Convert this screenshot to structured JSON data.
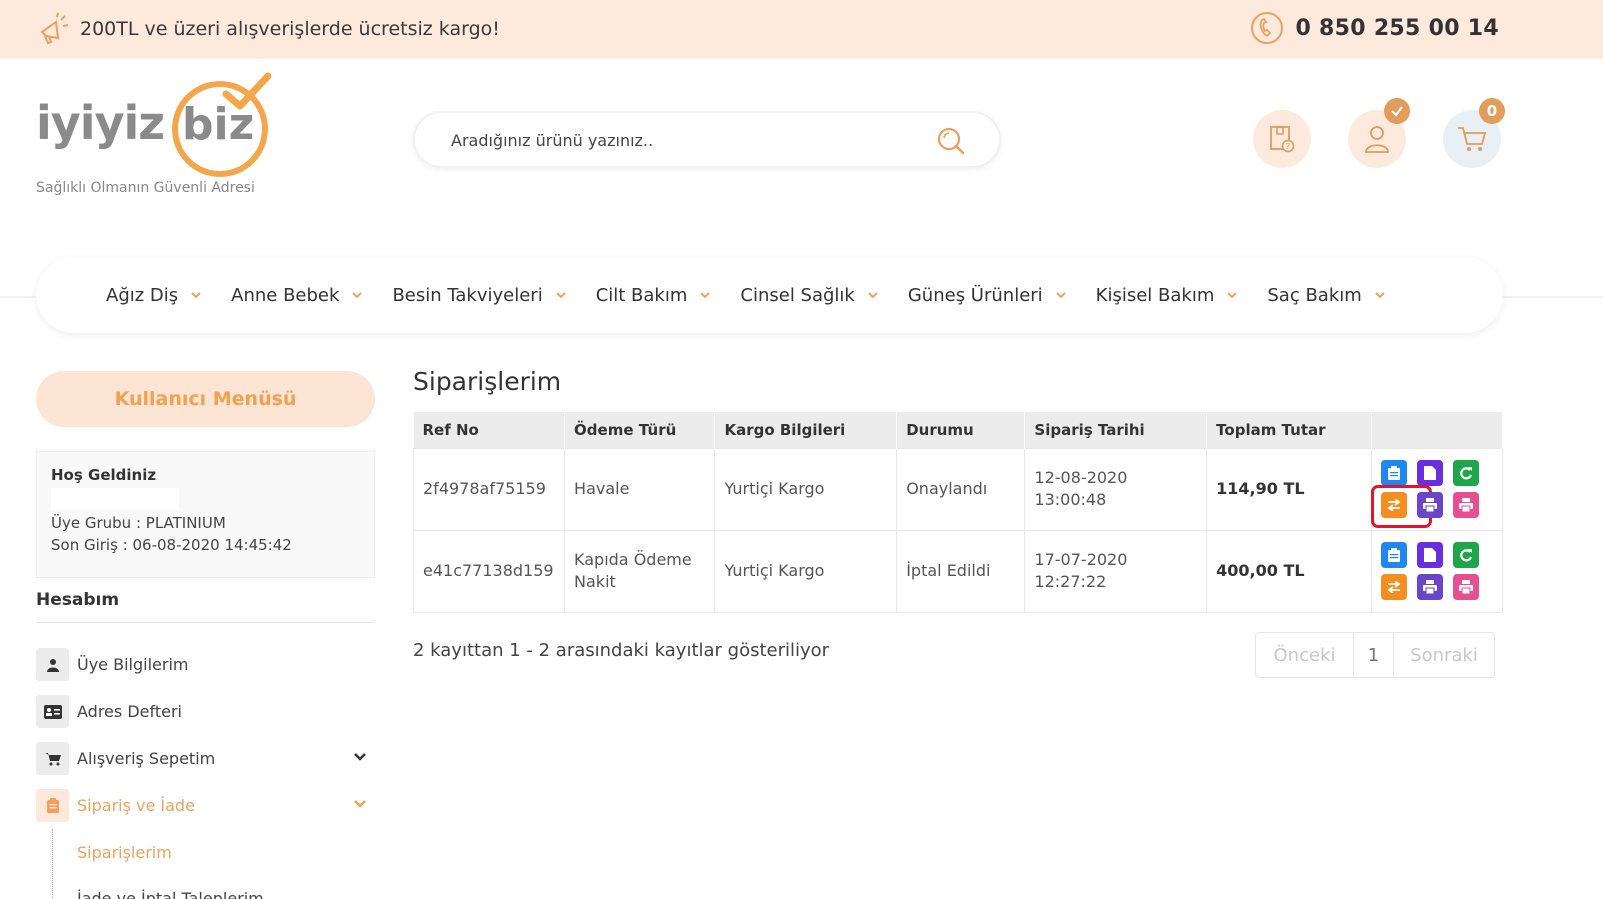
{
  "topbar": {
    "promo_text": "200TL ve üzeri alışverişlerde ücretsiz kargo!",
    "phone": "0 850 255 00 14"
  },
  "logo": {
    "word": "iyiyiz",
    "biz": "biz",
    "tagline": "Sağlıklı Olmanın Güvenli Adresi"
  },
  "search": {
    "placeholder": "Aradığınız ürünü yazınız.."
  },
  "header": {
    "cart_count": "0",
    "colors": {
      "accent": "#f4a64a",
      "badge": "#e39d5b",
      "topbar_bg": "#fdeadc"
    }
  },
  "nav": {
    "items": [
      "Ağız Diş",
      "Anne Bebek",
      "Besin Takviyeleri",
      "Cilt Bakım",
      "Cinsel Sağlık",
      "Güneş Ürünleri",
      "Kişisel Bakım",
      "Saç Bakım"
    ]
  },
  "sidebar": {
    "user_menu": "Kullanıcı Menüsü",
    "welcome_title": "Hoş Geldiniz",
    "member_group": "Üye Grubu : PLATINIUM",
    "last_login": "Son Giriş : 06-08-2020 14:45:42",
    "account_heading": "Hesabım",
    "items": [
      {
        "label": "Üye Bilgilerim",
        "icon": "user-icon"
      },
      {
        "label": "Adres Defteri",
        "icon": "address-card-icon"
      },
      {
        "label": "Alışveriş Sepetim",
        "icon": "cart-icon"
      },
      {
        "label": "Sipariş ve İade",
        "icon": "clipboard-icon"
      }
    ],
    "sub_items": [
      "Siparişlerim",
      "İade ve İptal Taleplerim"
    ]
  },
  "main": {
    "title": "Siparişlerim",
    "columns": [
      "Ref No",
      "Ödeme Türü",
      "Kargo Bilgileri",
      "Durumu",
      "Sipariş Tarihi",
      "Toplam Tutar",
      ""
    ],
    "rows": [
      {
        "ref": "2f4978af75159",
        "payment": "Havale",
        "cargo": "Yurtiçi Kargo",
        "status": "Onaylandı",
        "date": "12-08-2020",
        "time": "13:00:48",
        "total": "114,90 TL"
      },
      {
        "ref": "e41c77138d159",
        "payment": "Kapıda Ödeme Nakit",
        "cargo": "Yurtiçi Kargo",
        "status": "İptal Edildi",
        "date": "17-07-2020",
        "time": "12:27:22",
        "total": "400,00 TL"
      }
    ],
    "info": "2 kayıttan 1 - 2 arasındaki kayıtlar gösteriliyor",
    "pager": {
      "prev": "Önceki",
      "page": "1",
      "next": "Sonraki"
    }
  }
}
